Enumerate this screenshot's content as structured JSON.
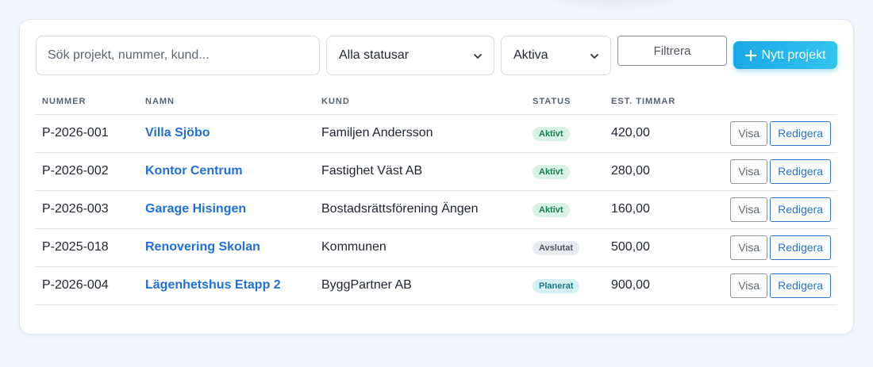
{
  "toolbar": {
    "search_placeholder": "Sök projekt, nummer, kund...",
    "status_select": "Alla statusar",
    "active_select": "Aktiva",
    "filter_label": "Filtrera",
    "new_project_label": "Nytt projekt"
  },
  "table": {
    "headers": [
      "NUMMER",
      "NAMN",
      "KUND",
      "STATUS",
      "EST. TIMMAR"
    ],
    "rows": [
      {
        "number": "P-2026-001",
        "name": "Villa Sjöbo",
        "customer": "Familjen Andersson",
        "status": "Aktivt",
        "hours": "420,00"
      },
      {
        "number": "P-2026-002",
        "name": "Kontor Centrum",
        "customer": "Fastighet Väst AB",
        "status": "Aktivt",
        "hours": "280,00"
      },
      {
        "number": "P-2026-003",
        "name": "Garage Hisingen",
        "customer": "Bostadsrättsförening Ängen",
        "status": "Aktivt",
        "hours": "160,00"
      },
      {
        "number": "P-2025-018",
        "name": "Renovering Skolan",
        "customer": "Kommunen",
        "status": "Avslutat",
        "hours": "500,00"
      },
      {
        "number": "P-2026-004",
        "name": "Lägenhetshus Etapp 2",
        "customer": "ByggPartner AB",
        "status": "Planerat",
        "hours": "900,00"
      }
    ],
    "view_label": "Visa",
    "edit_label": "Redigera"
  },
  "colors": {
    "accent": "#1aa8e6",
    "link": "#1f6fd8",
    "status_active_bg": "#d6f3e5",
    "status_done_bg": "#e8ebef",
    "status_planned_bg": "#d6f1f6"
  },
  "icons": {
    "dropdown": "chevron-down-icon",
    "add": "plus-icon"
  }
}
